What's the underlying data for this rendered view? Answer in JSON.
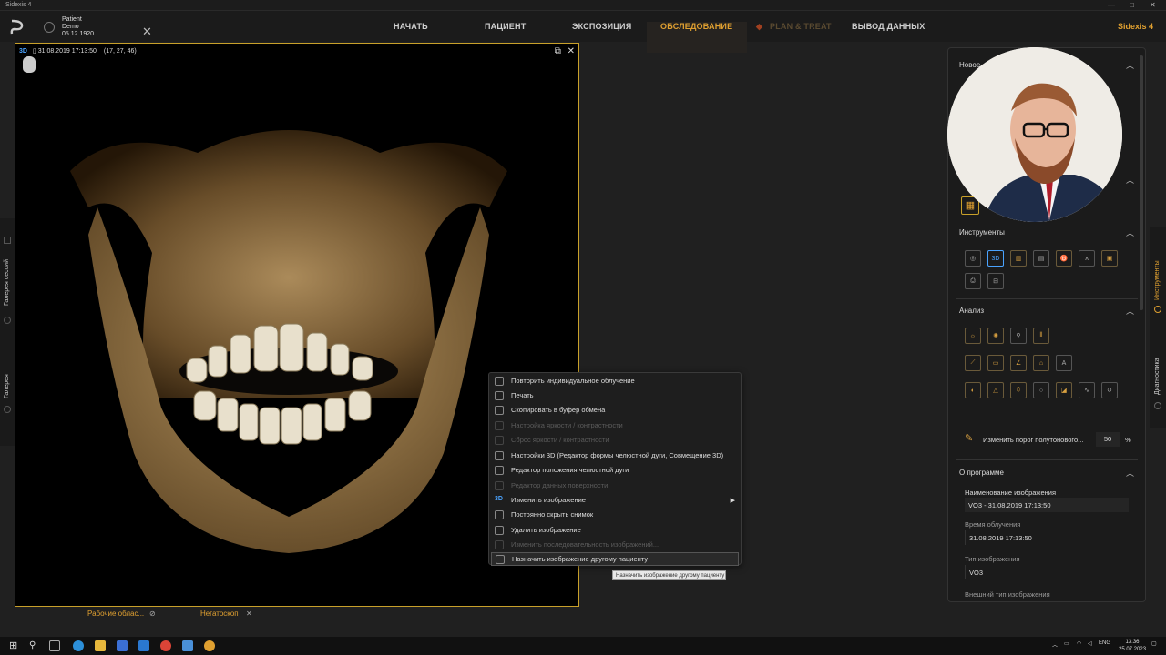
{
  "window": {
    "title": "Sidexis 4"
  },
  "patient": {
    "first": "Patient",
    "last": "Demo",
    "dob": "05.12.1920"
  },
  "nav": {
    "start": "НАЧАТЬ",
    "patient": "ПАЦИЕНТ",
    "exposure": "ЭКСПОЗИЦИЯ",
    "examination": "ОБСЛЕДОВАНИЕ",
    "plan": "PLAN & TREAT",
    "output": "ВЫВОД ДАННЫХ"
  },
  "brand": "Sidexis 4",
  "left_strip": {
    "sessions": "Галерея сессий",
    "gallery": "Галерея"
  },
  "viewer": {
    "badge": "3D",
    "timestamp": "31.08.2019 17:13:50",
    "coords": "(17, 27, 46)"
  },
  "bottom_tabs": {
    "workspaces": "Рабочие облас...",
    "viewbox": "Негатоскоп"
  },
  "context_menu": [
    {
      "label": "Повторить индивидуальное облучение",
      "enabled": true
    },
    {
      "label": "Печать",
      "enabled": true
    },
    {
      "label": "Скопировать в буфер обмена",
      "enabled": true
    },
    {
      "label": "Настройка яркости / контрастности",
      "enabled": false
    },
    {
      "label": "Сброс яркости / контрастности",
      "enabled": false
    },
    {
      "label": "Настройки 3D (Редактор формы челюстной дуги, Совмещение 3D)",
      "enabled": true
    },
    {
      "label": "Редактор положения челюстной дуги",
      "enabled": true
    },
    {
      "label": "Редактор данных поверхности",
      "enabled": false
    },
    {
      "label": "Изменить изображение",
      "enabled": true,
      "submenu": true
    },
    {
      "label": "Постоянно скрыть снимок",
      "enabled": true
    },
    {
      "label": "Удалить изображение",
      "enabled": true
    },
    {
      "label": "Изменить последовательность изображений...",
      "enabled": false
    },
    {
      "label": "Назначить изображение другому пациенту",
      "enabled": true,
      "highlighted": true
    }
  ],
  "tooltip": "Назначить изображение другому пациенту",
  "right_panel": {
    "new_section": "Новое",
    "tools_section": "Инструменты",
    "analysis_section": "Анализ",
    "threshold_label": "Изменить порог полутонового...",
    "threshold_value": "50",
    "threshold_unit": "%",
    "about_section": "О программе",
    "image_name_label": "Наименование изображения",
    "image_name_value": "VO3 - 31.08.2019 17:13:50",
    "exposure_time_label": "Время облучения",
    "exposure_time_value": "31.08.2019 17:13:50",
    "image_type_label": "Тип изображения",
    "image_type_value": "VO3",
    "external_type_label": "Внешний тип изображения"
  },
  "right_strip": {
    "tools": "Инструменты",
    "diagnostics": "Диагностика"
  },
  "taskbar": {
    "lang": "ENG",
    "time": "13:36",
    "date": "25.07.2023"
  },
  "colors": {
    "accent": "#e0a030",
    "frame": "#c8a02a",
    "blue": "#4aa3ff"
  }
}
